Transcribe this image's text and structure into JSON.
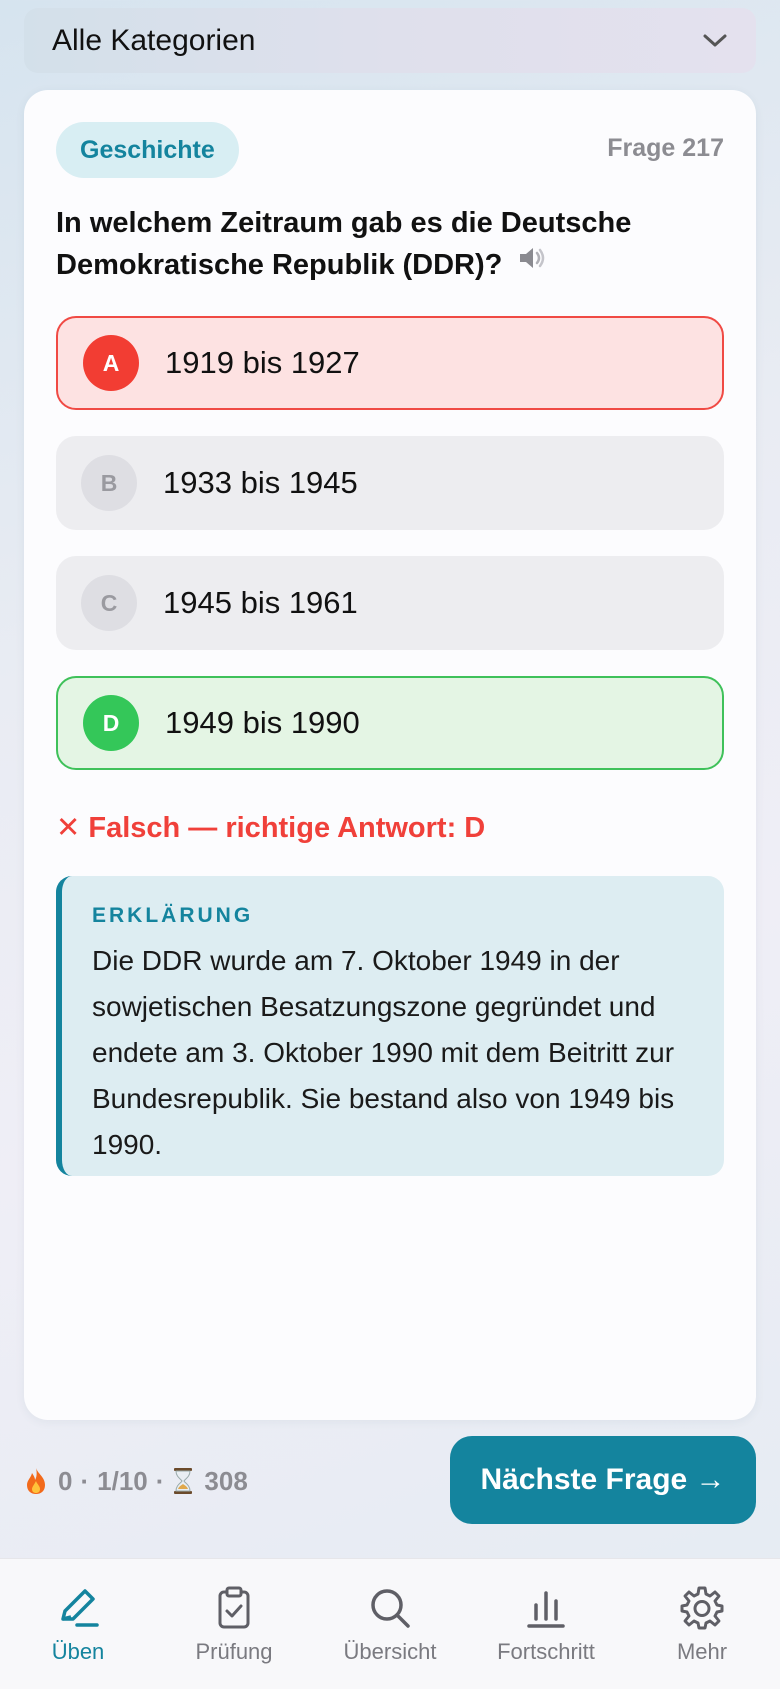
{
  "category_select": {
    "value": "Alle Kategorien"
  },
  "card": {
    "category_badge": "Geschichte",
    "question_number": "Frage 217",
    "question": "In welchem Zeitraum gab es die Deutsche Demokratische Republik (DDR)?",
    "options": [
      {
        "letter": "A",
        "text": "1919 bis 1927",
        "state": "wrong"
      },
      {
        "letter": "B",
        "text": "1933 bis 1945",
        "state": "neutral"
      },
      {
        "letter": "C",
        "text": "1945 bis 1961",
        "state": "neutral"
      },
      {
        "letter": "D",
        "text": "1949 bis 1990",
        "state": "correct"
      }
    ],
    "result": "✕ Falsch — richtige Antwort: D",
    "explanation": {
      "title": "ERKLÄRUNG",
      "text": "Die DDR wurde am 7. Oktober 1949 in der sowjetischen Besatzungszone gegründet und endete am 3. Oktober 1990 mit dem Beitritt zur Bundesrepublik. Sie bestand also von 1949 bis 1990."
    }
  },
  "stats": {
    "streak": "0",
    "progress": "1/10",
    "remaining": "308"
  },
  "next_button": "Nächste Frage →",
  "nav": [
    {
      "label": "Üben",
      "icon": "pencil-icon",
      "active": true
    },
    {
      "label": "Prüfung",
      "icon": "clipboard-check-icon",
      "active": false
    },
    {
      "label": "Übersicht",
      "icon": "search-icon",
      "active": false
    },
    {
      "label": "Fortschritt",
      "icon": "bar-chart-icon",
      "active": false
    },
    {
      "label": "Mehr",
      "icon": "gear-icon",
      "active": false
    }
  ],
  "colors": {
    "accent": "#14849e",
    "wrong": "#f23d33",
    "correct": "#34c759"
  }
}
